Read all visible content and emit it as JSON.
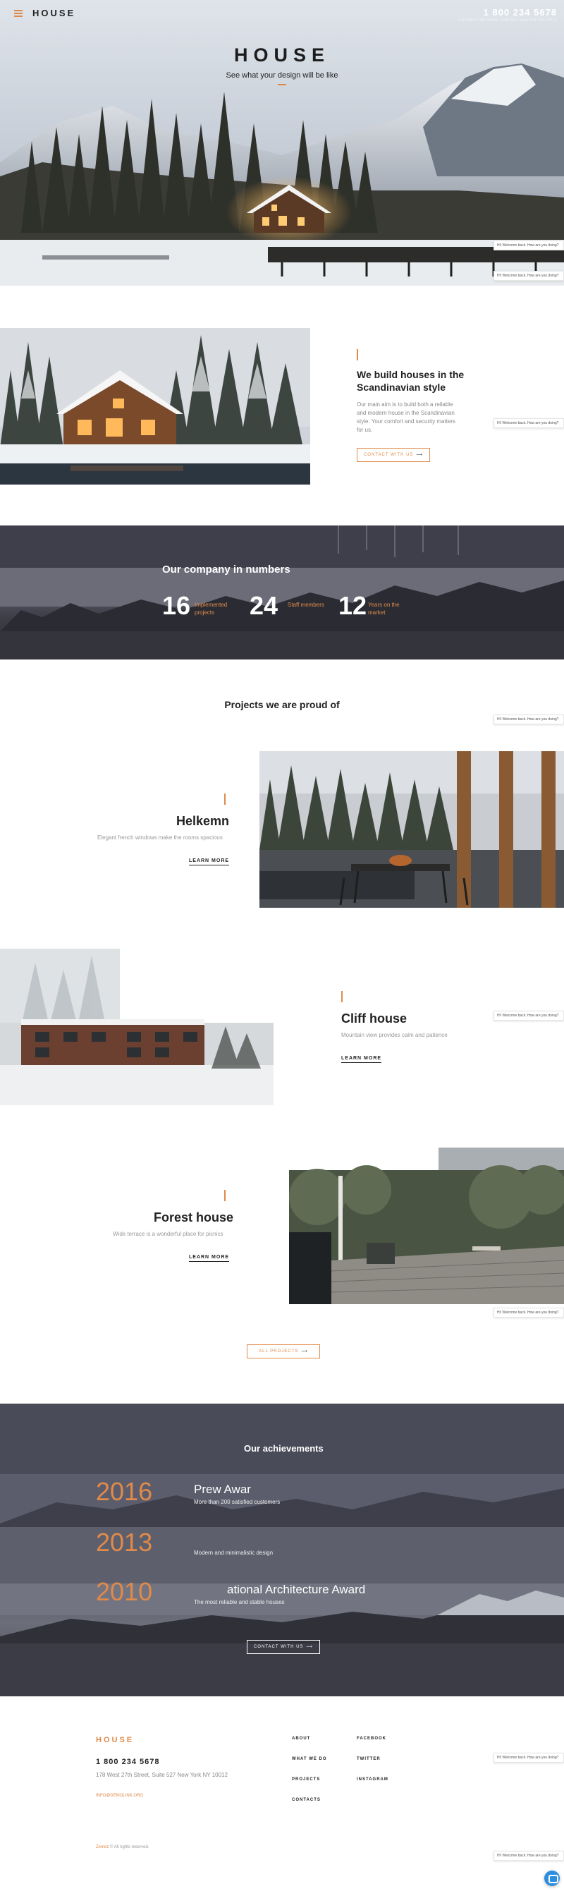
{
  "header": {
    "logo": "HOUSE",
    "phone": "1 800 234 5678",
    "address": "178 West 27th Street, Suite 527 New York NY 10012"
  },
  "hero": {
    "title": "HOUSE",
    "subtitle": "See what your design will be like"
  },
  "chat": {
    "message": "Hi! Welcome back. How are you doing?"
  },
  "about": {
    "title": "We build houses in the Scandinavian style",
    "text": "Our main aim is to build both a reliable and modern house in the Scandinavian style. Your comfort and security matters for us.",
    "button": "CONTACT WITH US"
  },
  "numbers": {
    "title": "Our company in numbers",
    "stats": [
      {
        "value": "16",
        "label": "Implemented projects"
      },
      {
        "value": "24",
        "label": "Staff members"
      },
      {
        "value": "12",
        "label": "Years on the market"
      }
    ]
  },
  "projects": {
    "title": "Projects we are proud of",
    "items": [
      {
        "title": "Helkemn",
        "description": "Elegant french windows make the rooms spacious",
        "link": "LEARN MORE"
      },
      {
        "title": "Cliff house",
        "description": "Mountain view provides calm and patience",
        "link": "LEARN MORE"
      },
      {
        "title": "Forest house",
        "description": "Wide terrace is a wonderful place for picnics",
        "link": "LEARN MORE"
      }
    ],
    "all_button": "ALL PROJECTS"
  },
  "achievements": {
    "title": "Our achievements",
    "items": [
      {
        "year": "2016",
        "award": "Prew Awar",
        "desc": "More than 200 satisfied customers"
      },
      {
        "year": "2013",
        "award": "",
        "desc": "Modern and minimalistic design"
      },
      {
        "year": "2010",
        "award": "ational Architecture Award",
        "desc": "The most reliable and stable houses"
      }
    ],
    "button": "CONTACT WITH US"
  },
  "footer": {
    "logo": "HOUSE",
    "phone": "1 800 234 5678",
    "address": "178 West 27th Street, Suite 527 New York NY 10012",
    "email": "INFO@DEMOLINK.ORG",
    "links_col1": [
      "ABOUT",
      "WHAT WE DO",
      "PROJECTS",
      "CONTACTS"
    ],
    "links_col2": [
      "FACEBOOK",
      "TWITTER",
      "INSTAGRAM"
    ],
    "copyright_brand": "Zemez",
    "copyright_text": "© All rights reserved."
  },
  "colors": {
    "accent": "#e08a4a",
    "dark": "#222222"
  }
}
